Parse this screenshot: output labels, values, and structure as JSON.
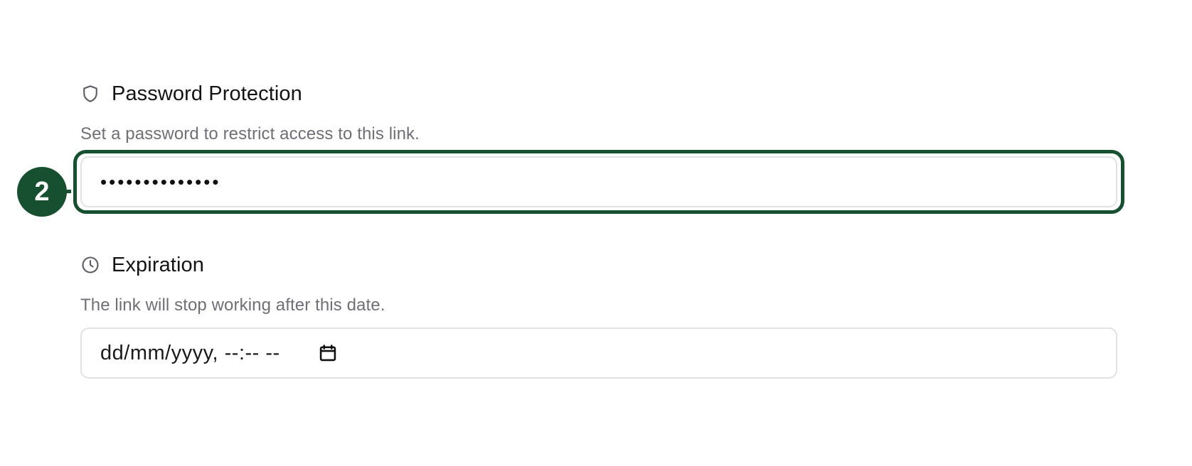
{
  "password_section": {
    "icon": "shield-icon",
    "title": "Password Protection",
    "description": "Set a password to restrict access to this link.",
    "input_value": "••••••••••••••"
  },
  "expiration_section": {
    "icon": "clock-icon",
    "title": "Expiration",
    "description": "The link will stop working after this date.",
    "input_value": "dd/mm/yyyy, --:-- --",
    "picker_icon": "calendar-icon"
  },
  "annotation": {
    "step_number": "2",
    "color": "#174f31"
  },
  "colors": {
    "accent": "#174f31",
    "border": "#e2e2e4",
    "muted_text": "#6f6f76"
  }
}
